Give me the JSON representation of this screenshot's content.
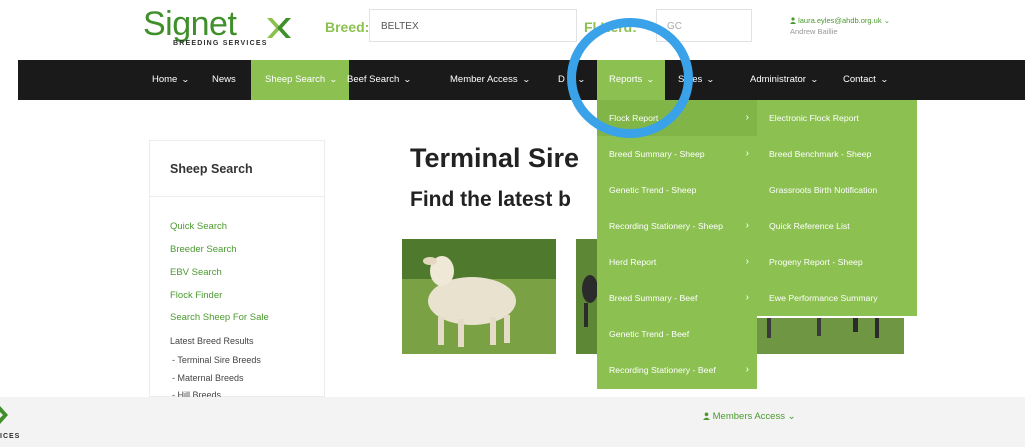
{
  "logo": {
    "word": "Signet",
    "sub": "BREEDING SERVICES",
    "mark": "signet-chevron-logo"
  },
  "search": {
    "breed_label": "Breed:",
    "breed_value": "BELTEX",
    "flock_label": "Fl    Herd:",
    "flock_value": "    GC"
  },
  "user": {
    "email": "laura.eyles@ahdb.org.uk",
    "name": "Andrew Baillie",
    "icon": "user-icon"
  },
  "nav": {
    "items": [
      {
        "label": "Home",
        "chevron": true
      },
      {
        "label": "News",
        "chevron": false
      },
      {
        "label": "Sheep Search",
        "chevron": true
      },
      {
        "label": "Beef Search",
        "chevron": true
      },
      {
        "label": "Member Access",
        "chevron": true
      },
      {
        "label": "D    a",
        "chevron": true
      },
      {
        "label": "Reports",
        "chevron": true
      },
      {
        "label": "Se    es",
        "chevron": true
      },
      {
        "label": "Administrator",
        "chevron": true
      },
      {
        "label": "Contact",
        "chevron": true
      }
    ]
  },
  "sidebar": {
    "title": "Sheep Search",
    "links": [
      "Quick Search",
      "Breeder Search",
      "EBV Search",
      "Flock Finder",
      "Search Sheep For Sale"
    ],
    "static": "Latest Breed Results",
    "sub": [
      "- Terminal Sire Breeds",
      "- Maternal Breeds",
      "- Hill Breeds"
    ]
  },
  "main": {
    "title": "Terminal Sire",
    "subtitle": "Find the latest b"
  },
  "reports_menu": [
    {
      "label": "Flock Report",
      "arrow": true
    },
    {
      "label": "Breed Summary - Sheep",
      "arrow": true
    },
    {
      "label": "Genetic Trend - Sheep",
      "arrow": false
    },
    {
      "label": "Recording Stationery - Sheep",
      "arrow": true
    },
    {
      "label": "Herd Report",
      "arrow": true
    },
    {
      "label": "Breed Summary - Beef",
      "arrow": true
    },
    {
      "label": "Genetic Trend - Beef",
      "arrow": false
    },
    {
      "label": "Recording Stationery - Beef",
      "arrow": true
    }
  ],
  "flock_submenu": [
    {
      "label": "Electronic Flock Report"
    },
    {
      "label": "Breed Benchmark - Sheep"
    },
    {
      "label": "Grassroots Birth Notification"
    },
    {
      "label": "Quick Reference List"
    },
    {
      "label": "Progeny Report - Sheep"
    },
    {
      "label": "Ewe Performance Summary"
    }
  ],
  "footer": {
    "members_access": "Members Access",
    "logo_sub": "ICES"
  },
  "colors": {
    "brand_green": "#8cc152",
    "dark_green": "#3f8f2a",
    "nav_bg": "#1a1a1a",
    "highlight_circle": "#3aa2e8"
  }
}
